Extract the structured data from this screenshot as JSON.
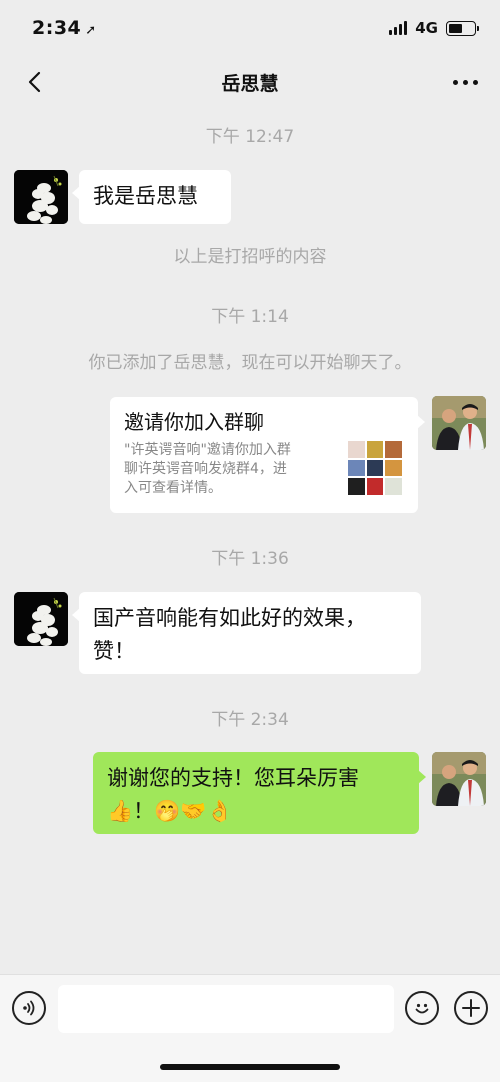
{
  "status_bar": {
    "time": "2:34",
    "network": "4G"
  },
  "nav": {
    "title": "岳思慧"
  },
  "messages": {
    "time1": "下午 12:47",
    "msg1": "我是岳思慧",
    "sys1": "以上是打招呼的内容",
    "time2": "下午 1:14",
    "sys2": "你已添加了岳思慧，现在可以开始聊天了。",
    "card": {
      "title": "邀请你加入群聊",
      "desc_line1": "\"许英谔音响\"邀请你加入群",
      "desc_line2": "聊许英谔音响发烧群4，进",
      "desc_line3": "入可查看详情。"
    },
    "time3": "下午 1:36",
    "msg2_line1": "国产音响能有如此好的效果，",
    "msg2_line2": "赞！",
    "time4": "下午 2:34",
    "msg3_line1": "谢谢您的支持！您耳朵厉害",
    "msg3_line2": "👍！🤭🤝👌"
  },
  "input": {
    "placeholder": ""
  },
  "colors": {
    "background": "#ededed",
    "sent_bubble": "#a0e75a",
    "received_bubble": "#ffffff",
    "timestamp": "#a8a8a8"
  },
  "icons": [
    "back-arrow-icon",
    "more-dots-icon",
    "voice-icon",
    "emoji-icon",
    "plus-icon",
    "location-arrow-icon",
    "signal-icon",
    "battery-icon"
  ]
}
